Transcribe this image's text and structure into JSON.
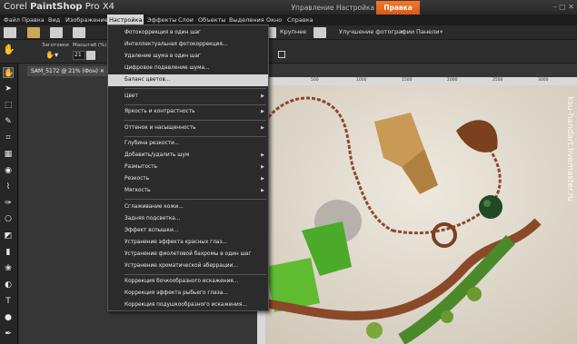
{
  "app": {
    "title_prefix": "Corel ",
    "title_brand": "PaintShop",
    "title_suffix": " Pro X4"
  },
  "mode_tabs": [
    "Управление",
    "Настройка",
    "Правка"
  ],
  "menubar": [
    "Файл",
    "Правка",
    "Вид",
    "Изображение",
    "Настройка",
    "Эффекты",
    "Слои",
    "Объекты",
    "Выделения",
    "Окно",
    "Справка"
  ],
  "toolbar": {
    "fit_label": "Крупнее",
    "enhance_label": "Улучшение фотографии",
    "panels_label": "Панели"
  },
  "options": {
    "presets_label": "Заготовки",
    "zoom_label": "Масштаб (%)",
    "zoom_value": "21"
  },
  "document": {
    "tab_label": "SAM_5172 @ 21% (Фон)"
  },
  "ruler": {
    "labels": [
      "0",
      "500",
      "1000",
      "1500",
      "2000",
      "2500",
      "3000"
    ]
  },
  "photo": {
    "watermark": "ksu-handart.livemaster.ru"
  },
  "menu": {
    "items": [
      {
        "label": "Фотокоррекция в один шаг",
        "submenu": false
      },
      {
        "label": "Интеллектуальная фотокоррекция...",
        "submenu": false
      },
      {
        "label": "Удаление шума в один шаг",
        "submenu": false
      },
      {
        "label": "Цифровое подавление шума...",
        "submenu": false
      },
      {
        "label": "Баланс цветов...",
        "submenu": false,
        "highlighted": true
      },
      {
        "label": "Цвет",
        "submenu": true
      },
      {
        "label": "Яркость и контрастность",
        "submenu": true
      },
      {
        "label": "Оттенок и насыщенность",
        "submenu": true
      },
      {
        "label": "Глубина резкости...",
        "submenu": false
      },
      {
        "label": "Добавить/удалить шум",
        "submenu": true
      },
      {
        "label": "Размытость",
        "submenu": true
      },
      {
        "label": "Резкость",
        "submenu": true
      },
      {
        "label": "Мягкость",
        "submenu": true
      },
      {
        "label": "Сглаживание кожи...",
        "submenu": false
      },
      {
        "label": "Задняя подсветка...",
        "submenu": false
      },
      {
        "label": "Эффект вспышки...",
        "submenu": false
      },
      {
        "label": "Устранение эффекта красных глаз...",
        "submenu": false
      },
      {
        "label": "Устранение фиолетовой бахромы в один шаг",
        "submenu": false
      },
      {
        "label": "Устранение хроматической аберрации...",
        "submenu": false
      },
      {
        "label": "Коррекция бочкообразного искажения...",
        "submenu": false
      },
      {
        "label": "Коррекция эффекта рыбьего глаза...",
        "submenu": false
      },
      {
        "label": "Коррекция подушкообразного искажения...",
        "submenu": false
      }
    ]
  },
  "colors": {
    "accent": "#e5661f",
    "menu_bg": "#2b2b2b",
    "highlight": "#d6d6d6"
  }
}
